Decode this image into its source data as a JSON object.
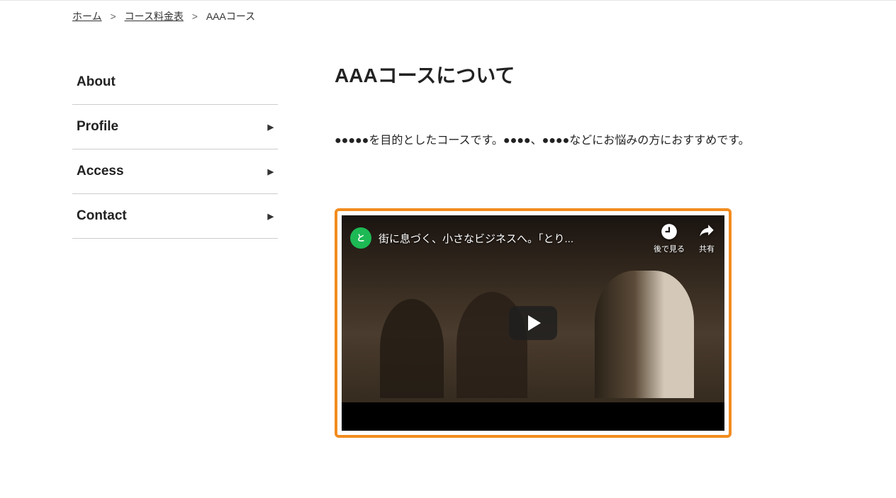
{
  "breadcrumb": {
    "items": [
      {
        "label": "ホーム",
        "link": true
      },
      {
        "label": "コース料金表",
        "link": true
      },
      {
        "label": "AAAコース",
        "link": false
      }
    ],
    "separator": ">"
  },
  "sidebar": {
    "items": [
      {
        "label": "About",
        "hasArrow": false
      },
      {
        "label": "Profile",
        "hasArrow": true
      },
      {
        "label": "Access",
        "hasArrow": true
      },
      {
        "label": "Contact",
        "hasArrow": true
      }
    ]
  },
  "main": {
    "title": "AAAコースについて",
    "description": "●●●●●を目的としたコースです。●●●●、●●●●などにお悩みの方におすすめです。"
  },
  "video": {
    "title": "街に息づく、小さなビジネスへ。「とり...",
    "watchLater": "後で見る",
    "share": "共有"
  },
  "colors": {
    "highlightBorder": "#f28c1e",
    "channelIcon": "#1db954"
  }
}
